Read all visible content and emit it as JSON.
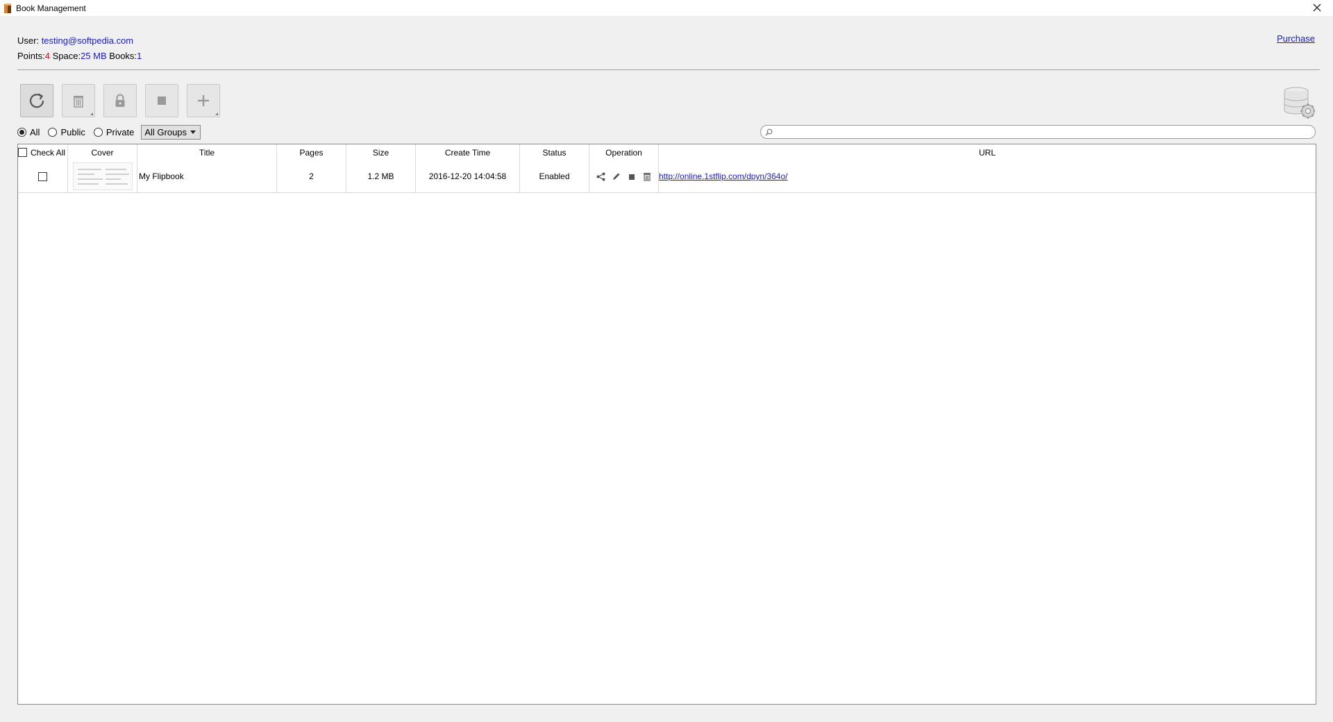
{
  "window": {
    "title": "Book Management"
  },
  "user": {
    "label": "User:",
    "email": "testing@softpedia.com",
    "points_label": "Points:",
    "points": "4",
    "space_label": "Space:",
    "space": "25 MB",
    "books_label": "Books:",
    "books": "1"
  },
  "purchase_label": "Purchase",
  "toolbar": {
    "buttons": [
      {
        "name": "refresh",
        "icon": "refresh-icon"
      },
      {
        "name": "delete",
        "icon": "trash-icon"
      },
      {
        "name": "lock",
        "icon": "lock-icon"
      },
      {
        "name": "stop",
        "icon": "stop-icon"
      },
      {
        "name": "add",
        "icon": "plus-icon"
      }
    ]
  },
  "filters": {
    "all": "All",
    "public": "Public",
    "private": "Private",
    "selected": "All",
    "group": "All Groups"
  },
  "search": {
    "placeholder": "",
    "value": ""
  },
  "table": {
    "check_all": "Check All",
    "columns": [
      "Cover",
      "Title",
      "Pages",
      "Size",
      "Create Time",
      "Status",
      "Operation",
      "URL"
    ],
    "rows": [
      {
        "title": "My Flipbook",
        "pages": "2",
        "size": "1.2 MB",
        "create_time": "2016-12-20 14:04:58",
        "status": "Enabled",
        "url": "http://online.1stflip.com/dpyn/364o/"
      }
    ]
  },
  "colors": {
    "link": "#1a1acc",
    "points": "#d01010"
  }
}
